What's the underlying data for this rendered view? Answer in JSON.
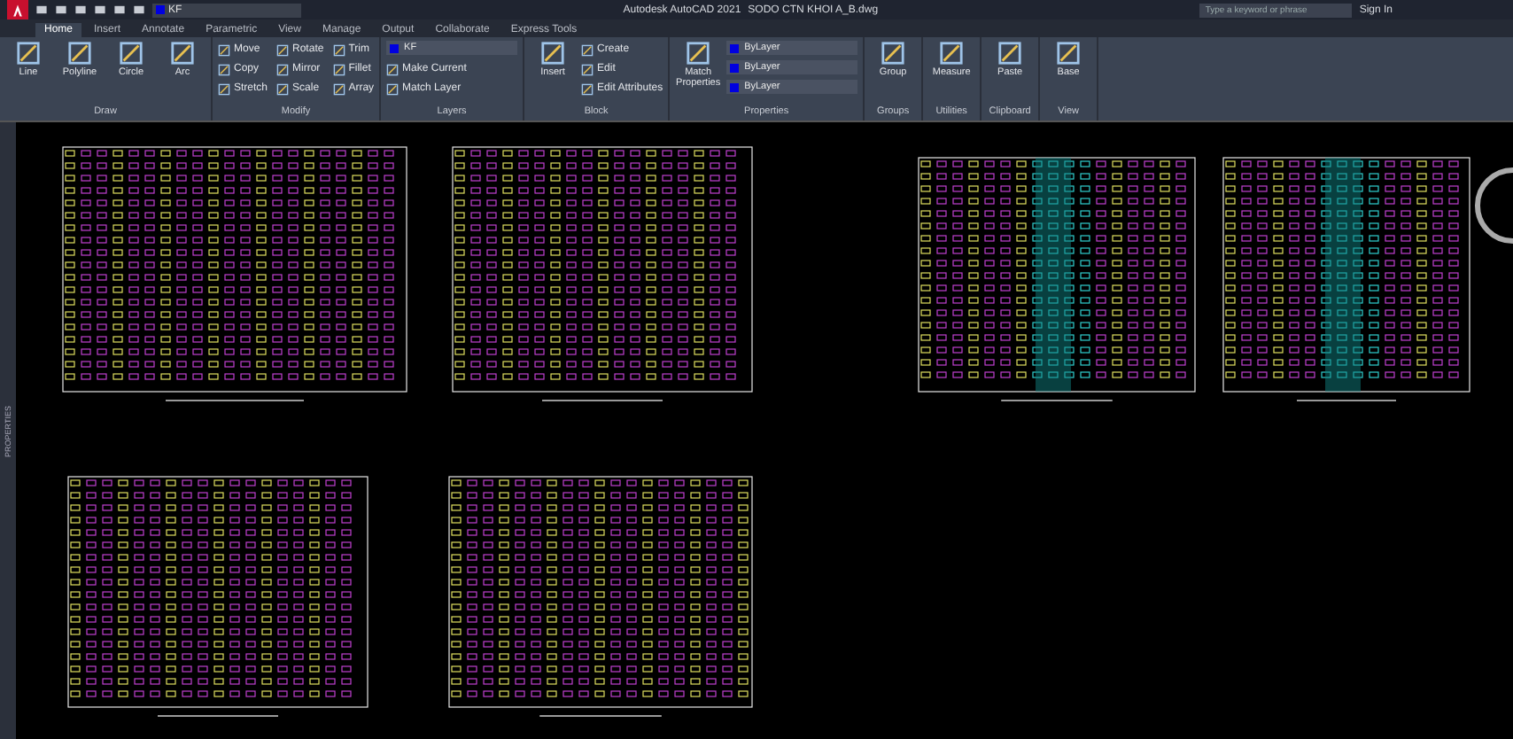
{
  "title_bar": {
    "quick_layer": "KF",
    "app_title": "Autodesk AutoCAD 2021",
    "file_name": "SODO CTN KHOI A_B.dwg",
    "search": {
      "placeholder": "Type a keyword or phrase"
    },
    "sign_in": "Sign In"
  },
  "tabs": [
    {
      "label": "Home",
      "selected": true
    },
    {
      "label": "Insert",
      "selected": false
    },
    {
      "label": "Annotate",
      "selected": false
    },
    {
      "label": "Parametric",
      "selected": false
    },
    {
      "label": "View",
      "selected": false
    },
    {
      "label": "Manage",
      "selected": false
    },
    {
      "label": "Output",
      "selected": false
    },
    {
      "label": "Collaborate",
      "selected": false
    },
    {
      "label": "Express Tools",
      "selected": false
    }
  ],
  "ribbon": {
    "panels": [
      {
        "title": "Draw",
        "tools": [
          {
            "kind": "large",
            "label": "Line"
          },
          {
            "kind": "large",
            "label": "Polyline"
          },
          {
            "kind": "large",
            "label": "Circle"
          },
          {
            "kind": "large",
            "label": "Arc"
          }
        ]
      },
      {
        "title": "Modify",
        "tools": [
          {
            "kind": "small",
            "label": "Move"
          },
          {
            "kind": "small",
            "label": "Copy"
          },
          {
            "kind": "small",
            "label": "Stretch"
          },
          {
            "kind": "small",
            "label": "Rotate"
          },
          {
            "kind": "small",
            "label": "Mirror"
          },
          {
            "kind": "small",
            "label": "Scale"
          },
          {
            "kind": "small",
            "label": "Trim"
          },
          {
            "kind": "small",
            "label": "Fillet"
          },
          {
            "kind": "small",
            "label": "Array"
          }
        ]
      },
      {
        "title": "Layers",
        "tools": [
          {
            "kind": "dropdown",
            "label": "KF"
          },
          {
            "kind": "small",
            "label": "Make Current"
          },
          {
            "kind": "small",
            "label": "Match Layer"
          }
        ]
      },
      {
        "title": "Block",
        "tools": [
          {
            "kind": "large",
            "label": "Insert"
          },
          {
            "kind": "small",
            "label": "Create"
          },
          {
            "kind": "small",
            "label": "Edit"
          },
          {
            "kind": "small",
            "label": "Edit Attributes"
          }
        ]
      },
      {
        "title": "Properties",
        "tools": [
          {
            "kind": "large",
            "label": "Match Properties"
          },
          {
            "kind": "dropdown",
            "label": "ByLayer"
          },
          {
            "kind": "dropdown",
            "label": "ByLayer"
          },
          {
            "kind": "dropdown",
            "label": "ByLayer"
          }
        ]
      },
      {
        "title": "Groups",
        "tools": [
          {
            "kind": "large",
            "label": "Group"
          }
        ]
      },
      {
        "title": "Utilities",
        "tools": [
          {
            "kind": "large",
            "label": "Measure"
          }
        ]
      },
      {
        "title": "Clipboard",
        "tools": [
          {
            "kind": "large",
            "label": "Paste"
          }
        ]
      },
      {
        "title": "View",
        "tools": [
          {
            "kind": "large",
            "label": "Base"
          }
        ]
      }
    ]
  },
  "side_palette": {
    "label": "PROPERTIES"
  }
}
